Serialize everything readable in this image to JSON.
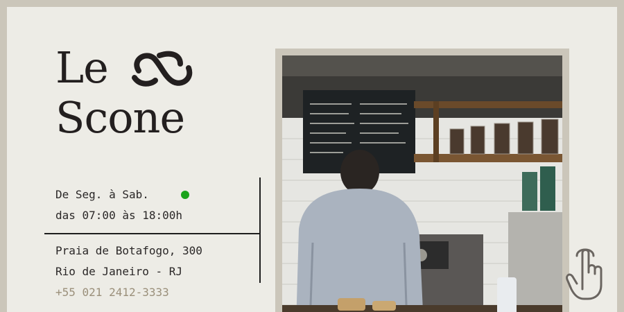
{
  "brand": {
    "line1": "Le",
    "line2": "Scone"
  },
  "hours": {
    "days": "De Seg. à Sab.",
    "time": "das 07:00 às 18:00h",
    "status_color": "#1aa31a"
  },
  "address": {
    "street": "Praia de Botafogo, 300",
    "city": "Rio de Janeiro - RJ",
    "phone": "+55 021 2412-3333"
  },
  "icons": {
    "logo": "scroll-s-icon",
    "cursor": "pointing-hand-icon"
  },
  "colors": {
    "background": "#edece6",
    "frame": "#cbc6ba",
    "text": "#231f1f",
    "phone": "#9a8f7a"
  }
}
